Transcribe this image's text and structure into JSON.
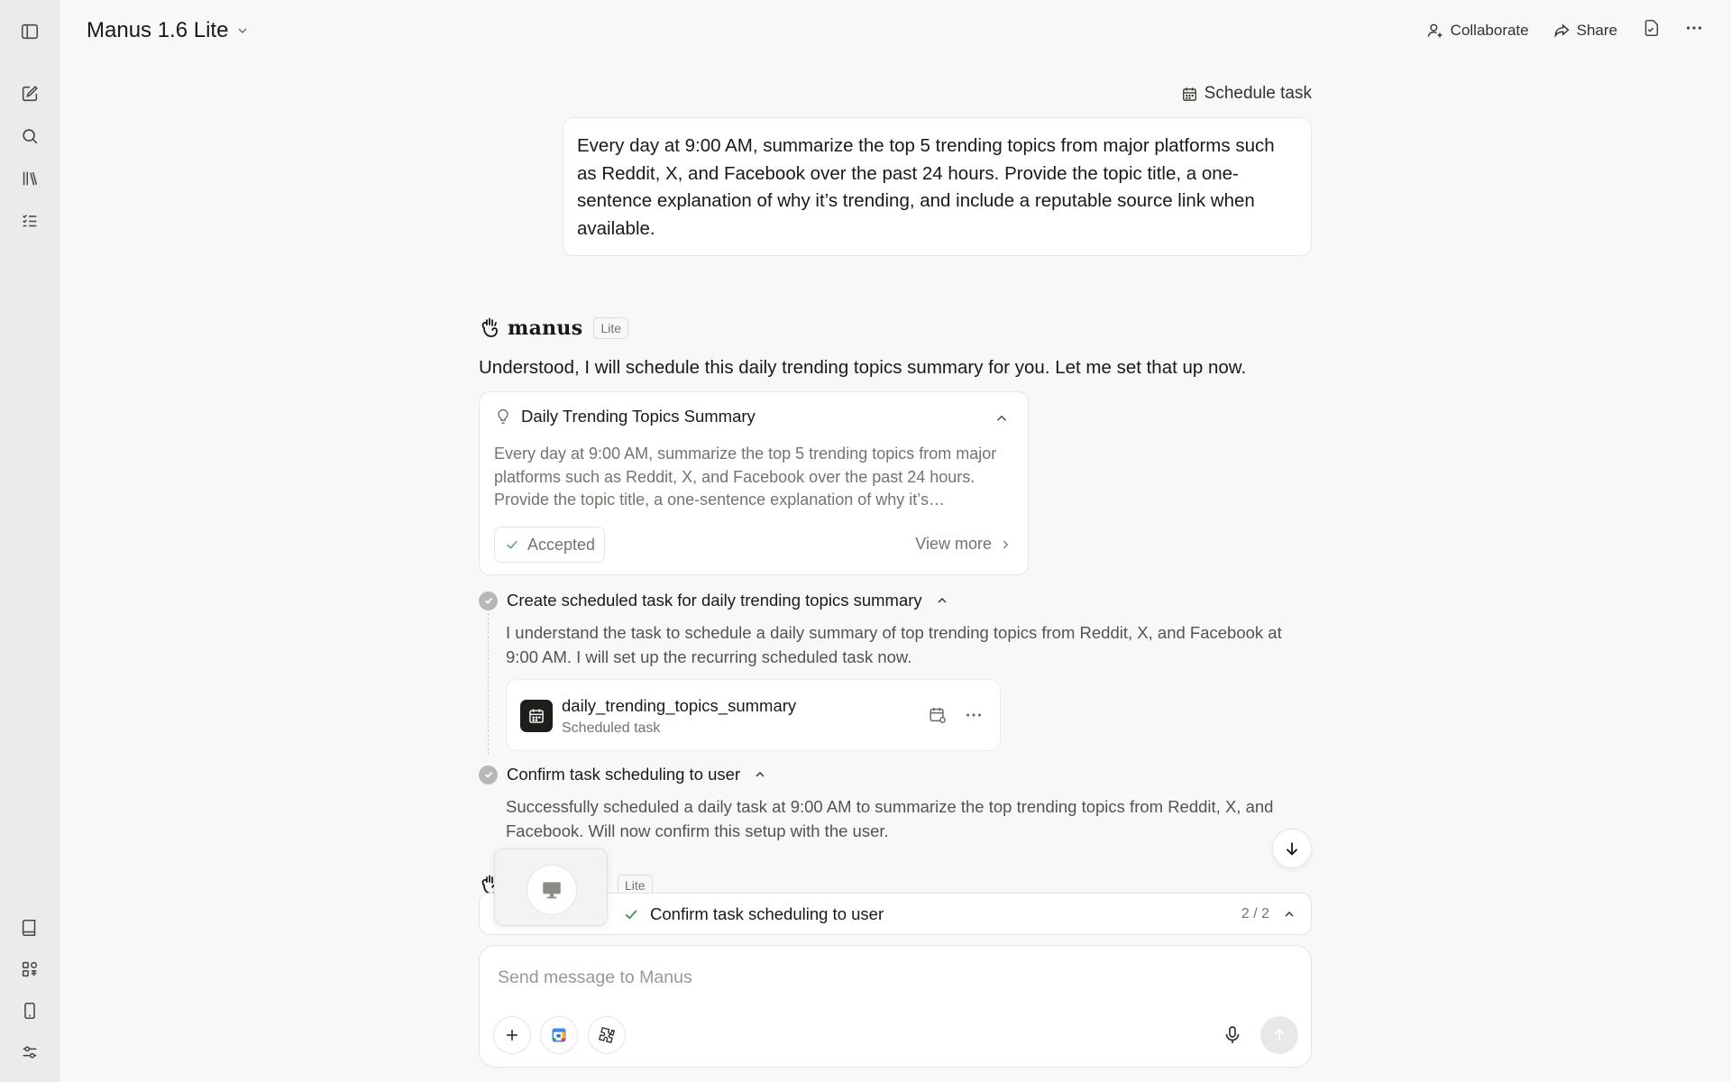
{
  "header": {
    "model_label": "Manus 1.6 Lite",
    "collaborate_label": "Collaborate",
    "share_label": "Share"
  },
  "sidebar": {
    "icons": [
      "sidebar-toggle-icon",
      "new-task-icon",
      "search-icon",
      "library-icon",
      "tasks-icon",
      "book-icon",
      "apps-icon",
      "mobile-icon",
      "settings-icon"
    ]
  },
  "conversation": {
    "schedule_label": "Schedule task",
    "user_message": "Every day at 9:00 AM, summarize the top 5 trending topics from major platforms such as Reddit, X, and Facebook over the past 24 hours. Provide the topic title, a one-sentence explanation of why it’s trending, and include a reputable source link when available.",
    "assistant_name": "manus",
    "assistant_badge": "Lite",
    "assistant_reply": "Understood, I will schedule this daily trending topics summary for you. Let me set that up now."
  },
  "task_card": {
    "title": "Daily Trending Topics Summary",
    "description": "Every day at 9:00 AM, summarize the top 5 trending topics from major platforms such as Reddit, X, and Facebook over the past 24 hours. Provide the topic title, a one-sentence explanation of why it’s…",
    "status": "Accepted",
    "view_more": "View more"
  },
  "steps": [
    {
      "title": "Create scheduled task for daily trending topics summary",
      "text": "I understand the task to schedule a daily summary of top trending topics from Reddit, X, and Facebook at 9:00 AM. I will set up the recurring scheduled task now."
    },
    {
      "title": "Confirm task scheduling to user",
      "text": "Successfully scheduled a daily task at 9:00 AM to summarize the top trending topics from Reddit, X, and Facebook. Will now confirm this setup with the user."
    }
  ],
  "file_card": {
    "name": "daily_trending_topics_summary",
    "type": "Scheduled task"
  },
  "progress": {
    "current_step": "Confirm task scheduling to user",
    "count": "2 / 2"
  },
  "composer": {
    "placeholder": "Send message to Manus"
  },
  "colors": {
    "sidebar_bg": "#ebebea",
    "page_bg": "#f8f8f7",
    "accept_green": "#5eae63"
  }
}
